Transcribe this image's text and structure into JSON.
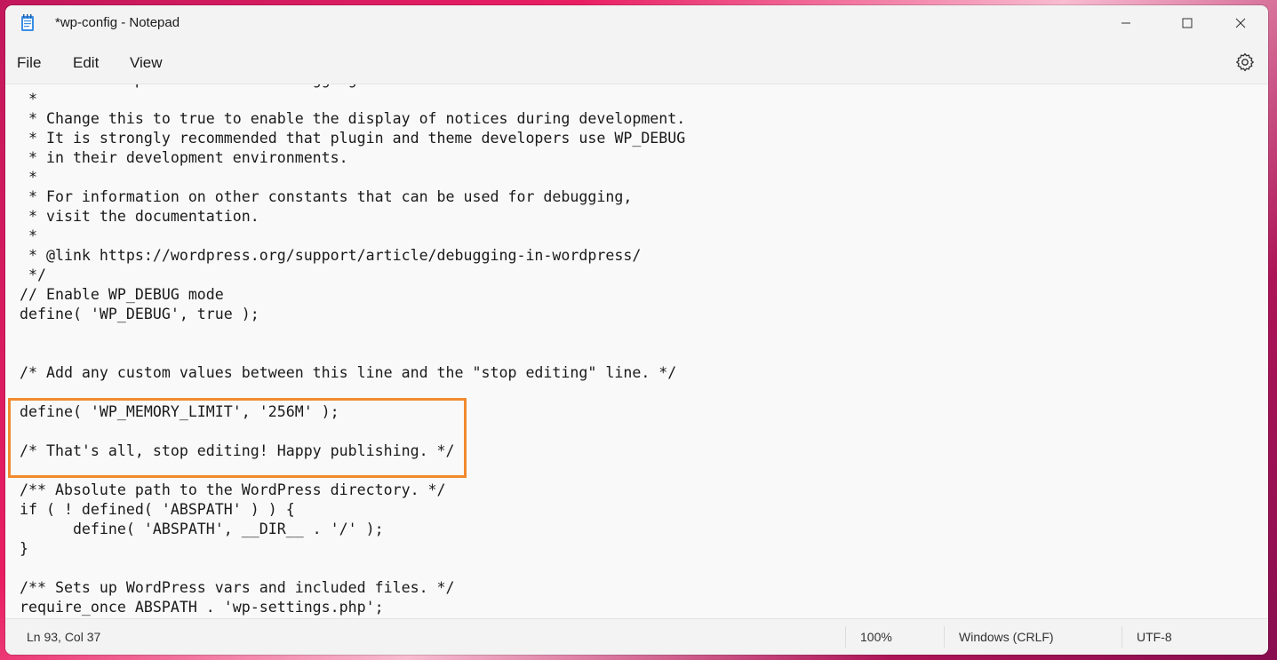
{
  "window": {
    "title": "*wp-config - Notepad"
  },
  "menu": {
    "file": "File",
    "edit": "Edit",
    "view": "View"
  },
  "icons": {
    "app": "notepad-icon",
    "minimize": "minimize-icon",
    "maximize": "maximize-icon",
    "close": "close-icon",
    "settings": "gear-icon"
  },
  "editor": {
    "lines": [
      " * For developers: WordPress debugging mode.",
      " *",
      " * Change this to true to enable the display of notices during development.",
      " * It is strongly recommended that plugin and theme developers use WP_DEBUG",
      " * in their development environments.",
      " *",
      " * For information on other constants that can be used for debugging,",
      " * visit the documentation.",
      " *",
      " * @link https://wordpress.org/support/article/debugging-in-wordpress/",
      " */",
      "// Enable WP_DEBUG mode",
      "define( 'WP_DEBUG', true );",
      "",
      "",
      "/* Add any custom values between this line and the \"stop editing\" line. */",
      "",
      "define( 'WP_MEMORY_LIMIT', '256M' );",
      "",
      "/* That's all, stop editing! Happy publishing. */",
      "",
      "/** Absolute path to the WordPress directory. */",
      "if ( ! defined( 'ABSPATH' ) ) {",
      "      define( 'ABSPATH', __DIR__ . '/' );",
      "}",
      "",
      "/** Sets up WordPress vars and included files. */",
      "require_once ABSPATH . 'wp-settings.php';"
    ],
    "highlight_color": "#f28a2e"
  },
  "status": {
    "position": "Ln 93, Col 37",
    "zoom": "100%",
    "line_ending": "Windows (CRLF)",
    "encoding": "UTF-8"
  }
}
